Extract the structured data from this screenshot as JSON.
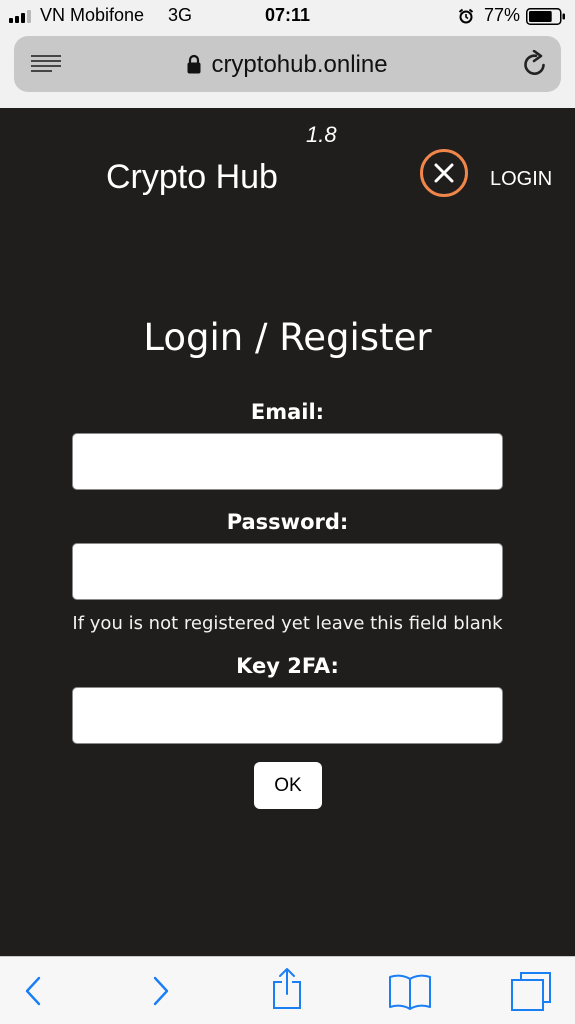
{
  "status_bar": {
    "carrier": "VN Mobifone",
    "network": "3G",
    "time": "07:11",
    "battery_percent": "77%",
    "battery_level": 0.77
  },
  "browser": {
    "url": "cryptohub.online"
  },
  "header": {
    "version": "1.8",
    "brand": "Crypto Hub",
    "login_link": "LOGIN",
    "accent_color": "#f0864a"
  },
  "form": {
    "title": "Login / Register",
    "email_label": "Email:",
    "email_value": "",
    "password_label": "Password:",
    "password_value": "",
    "password_hint": "If you is not registered yet leave this field blank",
    "key2fa_label": "Key 2FA:",
    "key2fa_value": "",
    "submit_label": "OK"
  },
  "toolbar": {
    "icons": [
      "back-icon",
      "forward-icon",
      "share-icon",
      "bookmarks-icon",
      "tabs-icon"
    ],
    "tint_color": "#1a7ef5"
  }
}
